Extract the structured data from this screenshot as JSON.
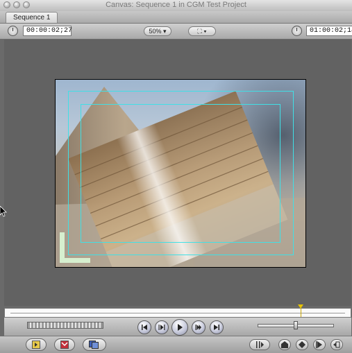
{
  "window": {
    "title": "Canvas: Sequence 1 in CGM Test Project"
  },
  "tabs": [
    {
      "label": "Sequence 1"
    }
  ],
  "toolbar": {
    "duration_timecode": "00:00:02;27",
    "zoom_label": "50%",
    "view_icon": "frame-view-icon",
    "current_timecode": "01:00:02;14"
  },
  "colors": {
    "safe_area_guides": "#3fe0e6",
    "playhead": "#e6c200",
    "background": "#626262"
  },
  "transport": {
    "buttons": [
      "go-to-previous-edit-icon",
      "play-in-to-out-icon",
      "play-icon",
      "play-around-current-icon",
      "go-to-next-edit-icon"
    ]
  },
  "bottom_buttons": {
    "left": [
      "insert-edit-icon",
      "overwrite-edit-icon",
      "replace-edit-icon"
    ],
    "right": [
      "match-frame-icon",
      "add-marker-icon",
      "add-keyframe-icon",
      "mark-clip-icon",
      "export-icon"
    ]
  }
}
